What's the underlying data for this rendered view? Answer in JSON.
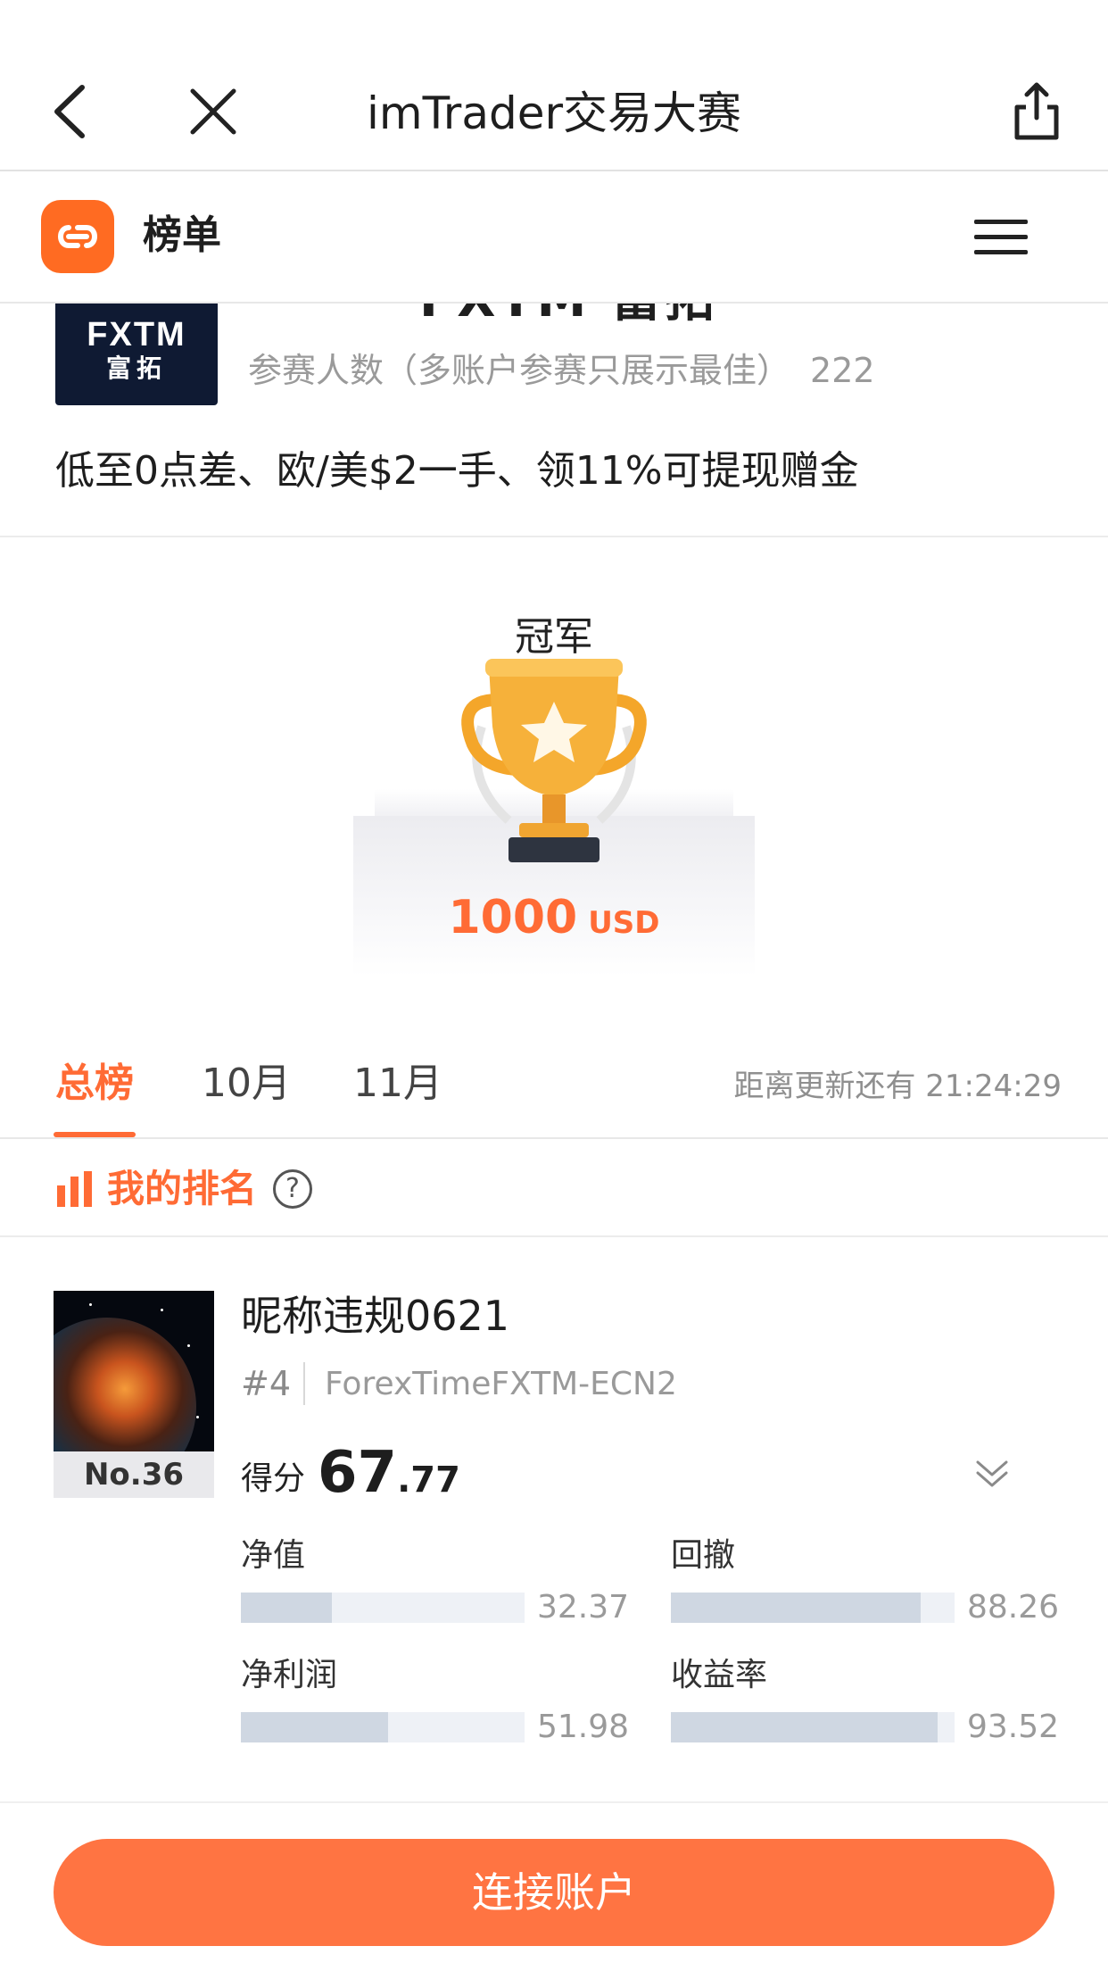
{
  "nav": {
    "title": "imTrader交易大赛"
  },
  "subheader": {
    "title": "榜单"
  },
  "broker": {
    "logo_line1": "FXTM",
    "logo_line2": "富拓",
    "name_partial": "FXTM 富拓",
    "participants_label": "参赛人数（多账户参赛只展示最佳）",
    "participants_count": "222",
    "promo": "低至0点差、欧/美$2一手、领11%可提现赠金"
  },
  "prize": {
    "label": "冠军",
    "amount": "1000",
    "currency": "USD"
  },
  "tabs": {
    "items": [
      {
        "label": "总榜",
        "active": true
      },
      {
        "label": "10月",
        "active": false
      },
      {
        "label": "11月",
        "active": false
      }
    ],
    "countdown": "距离更新还有 21:24:29"
  },
  "my_rank": {
    "label": "我的排名",
    "help": "?"
  },
  "card": {
    "rank_no": "No.36",
    "nickname": "昵称违规0621",
    "position": "#4",
    "server": "ForexTimeFXTM-ECN2",
    "score_label": "得分",
    "score_int": "67",
    "score_dec": ".77",
    "metrics": [
      {
        "label": "净值",
        "value": "32.37",
        "fill": 0.32
      },
      {
        "label": "回撤",
        "value": "88.26",
        "fill": 0.88
      },
      {
        "label": "净利润",
        "value": "51.98",
        "fill": 0.52
      },
      {
        "label": "收益率",
        "value": "93.52",
        "fill": 0.94
      }
    ]
  },
  "bottom": {
    "connect_label": "连接账户"
  },
  "colors": {
    "accent": "#ff6b35",
    "button": "#ff7442",
    "bar_fill": "#cfd7e2",
    "bar_track": "#eef1f6"
  }
}
